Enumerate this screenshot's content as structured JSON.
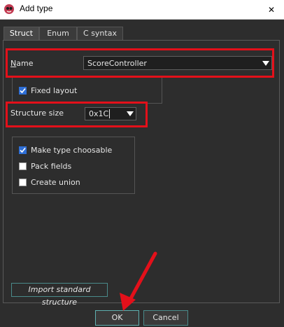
{
  "window": {
    "title": "Add type",
    "close_glyph": "✕"
  },
  "tabs": [
    {
      "label": "Struct",
      "active": true
    },
    {
      "label": "Enum",
      "active": false
    },
    {
      "label": "C syntax",
      "active": false
    }
  ],
  "struct": {
    "name_label_mnemonic": "N",
    "name_label_rest": "ame",
    "name_value": "ScoreController",
    "fixed_layout_label": "Fixed layout",
    "fixed_layout_checked": true,
    "size_label": "Structure size",
    "size_value": "0x1C",
    "options": [
      {
        "label": "Make type choosable",
        "checked": true
      },
      {
        "label": "Pack fields",
        "checked": false
      },
      {
        "label": "Create union",
        "checked": false
      }
    ],
    "import_label": "Import standard structure"
  },
  "buttons": {
    "ok": "OK",
    "cancel": "Cancel"
  },
  "colors": {
    "highlight": "#e3101a",
    "checkbox_on": "#2f6fd6",
    "background": "#2d2d2d"
  }
}
